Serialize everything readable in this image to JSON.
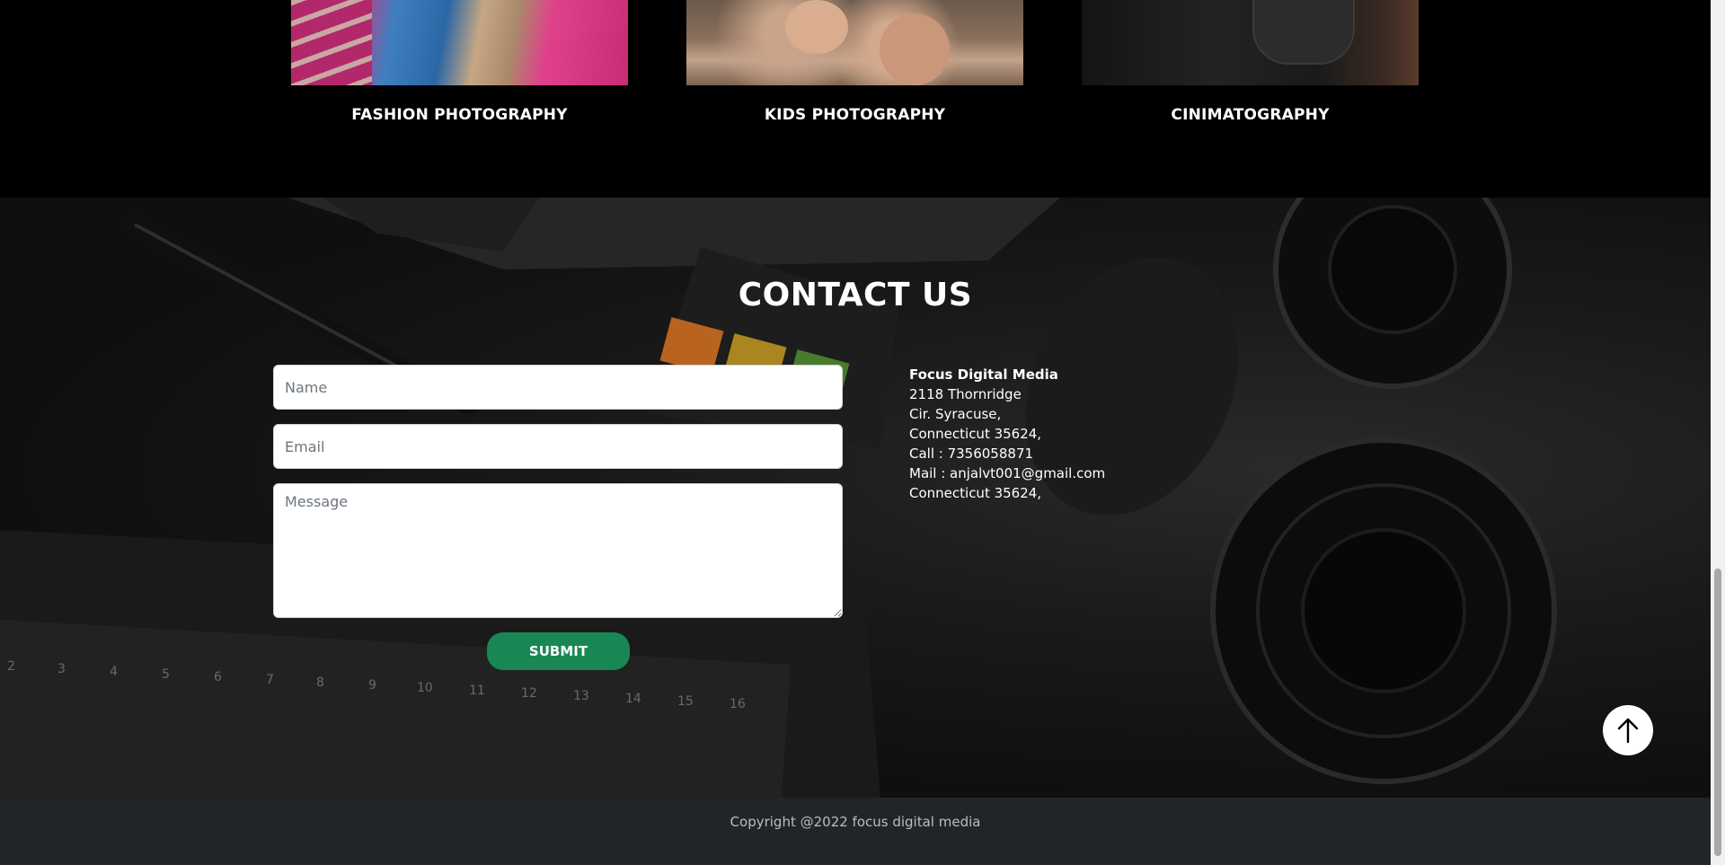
{
  "services": {
    "cards": [
      {
        "title": "FASHION PHOTOGRAPHY"
      },
      {
        "title": "KIDS PHOTOGRAPHY"
      },
      {
        "title": "CINIMATOGRAPHY"
      }
    ]
  },
  "contact": {
    "title": "CONTACT US",
    "form": {
      "name_placeholder": "Name",
      "email_placeholder": "Email",
      "message_placeholder": "Message",
      "submit_label": "SUBMIT"
    },
    "address": {
      "company": "Focus Digital Media",
      "line1": "2118 Thornridge",
      "line2": "Cir. Syracuse,",
      "line3": "Connecticut 35624,",
      "phone": "Call : 7356058871",
      "mail": "Mail : anjalvt001@gmail.com",
      "line4": "Connecticut 35624,"
    }
  },
  "footer": {
    "copyright": "Copyright @2022 focus digital media"
  },
  "icons": {
    "to_top": "arrow-up-icon"
  },
  "colors": {
    "submit": "#198754",
    "footer": "#212529"
  }
}
